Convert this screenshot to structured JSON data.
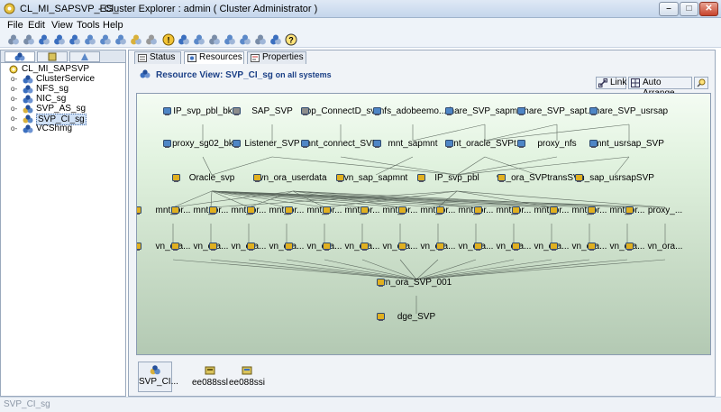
{
  "window": {
    "name": "CL_MI_SAPSVP_ES_",
    "title": "- Cluster Explorer : admin ( Cluster Administrator )",
    "minimize_glyph": "–",
    "maximize_glyph": "□",
    "close_glyph": "✕"
  },
  "menu": [
    "File",
    "Edit",
    "View",
    "Tools",
    "Help"
  ],
  "toolbar_icons": [
    "connect-icon",
    "disconnect-icon",
    "group-icon",
    "group-online-icon",
    "group-offline-icon",
    "resource-icon",
    "resource-online-icon",
    "resource-offline-icon",
    "wizard-icon",
    "stop-icon",
    "alert-icon",
    "probe-icon",
    "config-icon",
    "import-icon",
    "template-icon",
    "query-icon",
    "logs-icon",
    "command-icon",
    "help-icon"
  ],
  "left_panel": {
    "tabs": [
      "service-groups-tab",
      "systems-tab",
      "types-tab"
    ],
    "tree": [
      {
        "label": "CL_MI_SAPSVP",
        "icon": "cluster-icon",
        "level": 0
      },
      {
        "label": "ClusterService",
        "icon": "service-group-icon",
        "level": 1
      },
      {
        "label": "NFS_sg",
        "icon": "service-group-icon",
        "level": 1
      },
      {
        "label": "NIC_sg",
        "icon": "service-group-icon",
        "level": 1
      },
      {
        "label": "SVP_AS_sg",
        "icon": "service-group-partial-icon",
        "level": 1
      },
      {
        "label": "SVP_CI_sg",
        "icon": "service-group-partial-icon",
        "level": 1,
        "selected": true
      },
      {
        "label": "VCShmg",
        "icon": "service-group-icon",
        "level": 1
      }
    ]
  },
  "right_panel": {
    "tabs": [
      {
        "label": "Status",
        "icon": "status-icon"
      },
      {
        "label": "Resources",
        "icon": "resources-icon",
        "active": true
      },
      {
        "label": "Properties",
        "icon": "properties-icon"
      }
    ],
    "resource_view_title": "Resource View: SVP_CI_sg",
    "resource_view_suffix": "on all systems",
    "buttons": [
      {
        "label": "Link",
        "icon": "link-icon"
      },
      {
        "label": "Auto Arrange",
        "icon": "auto-arrange-icon"
      },
      {
        "label": "",
        "icon": "search-icon"
      }
    ]
  },
  "graph": {
    "rows": [
      [
        "IP_svp_pbl_bk",
        "SAP_SVP",
        "app_ConnectD_svp",
        "nfs_adobeemo...",
        "share_SVP_sapmnt",
        "share_SVP_sapt...",
        "share_SVP_usrsap"
      ],
      [
        "proxy_sg02_bk",
        "Listener_SVP",
        "mnt_connect_SVP",
        "mnt_sapmnt",
        "mnt_oracle_SVPt...",
        "proxy_nfs",
        "mnt_usrsap_SVP"
      ],
      [
        "Oracle_svp",
        "vn_ora_userdata",
        "vn_sap_sapmnt",
        "IP_svp_pbl",
        "vn_ora_SVPtransSV",
        "vn_sap_usrsapSVP"
      ],
      [
        "mnt_or...",
        "mnt_or...",
        "mnt_or...",
        "mnt_or...",
        "mnt_or...",
        "mnt_or...",
        "mnt_or...",
        "mnt_or...",
        "mnt_or...",
        "mnt_or...",
        "mnt_or...",
        "mnt_or...",
        "mnt_or...",
        "proxy_..."
      ],
      [
        "vn_ora...",
        "vn_ora...",
        "vn_ora...",
        "vn_ora...",
        "vn_ora...",
        "vn_ora...",
        "vn_ora...",
        "vn_ora...",
        "vn_ora...",
        "vn_ora...",
        "vn_ora...",
        "vn_ora...",
        "vn_ora...",
        "vn_ora..."
      ],
      [
        "vn_ora_SVP_001"
      ],
      [
        "dge_SVP"
      ]
    ]
  },
  "systems": {
    "group_label": "SVP_CI...",
    "items": [
      "ee088ssl",
      "ee088ssi"
    ]
  },
  "status_text": "SVP_CI_sg"
}
